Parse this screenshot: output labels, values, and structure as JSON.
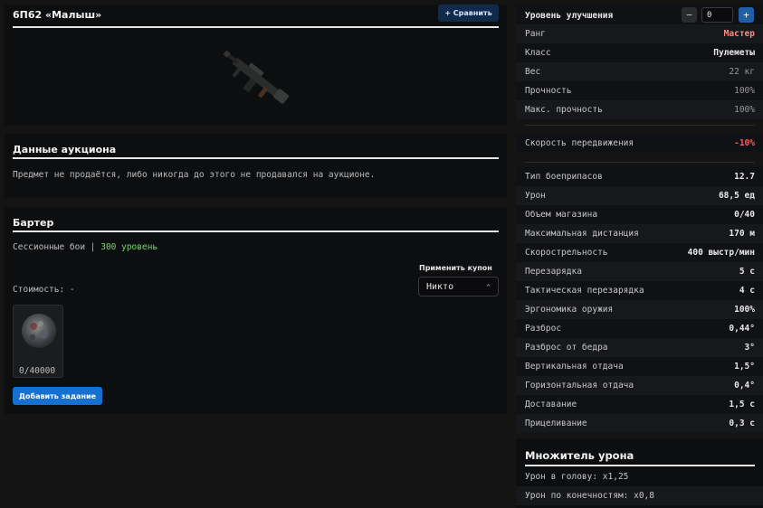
{
  "item": {
    "title": "6П62 «Малыш»",
    "compare_label": "+ Сравнить"
  },
  "auction": {
    "title": "Данные аукциона",
    "text": "Предмет не продаётся, либо никогда до этого не продавался на аукционе."
  },
  "barter": {
    "title": "Бартер",
    "requirement_prefix": "Сессионные бои | ",
    "requirement_level": "300 уровень",
    "coupon_label": "Применить купон",
    "coupon_value": "Никто",
    "cost_label": "Стоимость: -",
    "card_count": "0/40000",
    "add_task_label": "Добавить задание"
  },
  "upgrade": {
    "label": "Уровень улучшения",
    "value": "0",
    "minus": "−",
    "plus": "+"
  },
  "stats": [
    {
      "label": "Ранг",
      "value": "Мастер",
      "style": "salmon"
    },
    {
      "label": "Класс",
      "value": "Пулеметы",
      "style": ""
    },
    {
      "label": "Вес",
      "value": "22 кг",
      "style": "dim"
    },
    {
      "label": "Прочность",
      "value": "100%",
      "style": "dim"
    },
    {
      "label": "Макс. прочность",
      "value": "100%",
      "style": "dim"
    }
  ],
  "movement": {
    "label": "Скорость передвижения",
    "value": "-10%"
  },
  "combat_stats": [
    {
      "label": "Тип боеприпасов",
      "value": "12.7"
    },
    {
      "label": "Урон",
      "value": "68,5 ед"
    },
    {
      "label": "Объем магазина",
      "value": "0/40"
    },
    {
      "label": "Максимальная дистанция",
      "value": "170 м"
    },
    {
      "label": "Скорострельность",
      "value": "400 выстр/мин"
    },
    {
      "label": "Перезарядка",
      "value": "5 с"
    },
    {
      "label": "Тактическая перезарядка",
      "value": "4 с"
    },
    {
      "label": "Эргономика оружия",
      "value": "100%"
    },
    {
      "label": "Разброс",
      "value": "0,44°"
    },
    {
      "label": "Разброс от бедра",
      "value": "3°"
    },
    {
      "label": "Вертикальная отдача",
      "value": "1,5°"
    },
    {
      "label": "Горизонтальная отдача",
      "value": "0,4°"
    },
    {
      "label": "Доставание",
      "value": "1,5 с"
    },
    {
      "label": "Прицеливание",
      "value": "0,3 с"
    }
  ],
  "damage_mult": {
    "title": "Множитель урона",
    "rows": [
      {
        "text": "Урон в голову: x1,25"
      },
      {
        "text": "Урон по конечностям: x0,8"
      }
    ]
  }
}
